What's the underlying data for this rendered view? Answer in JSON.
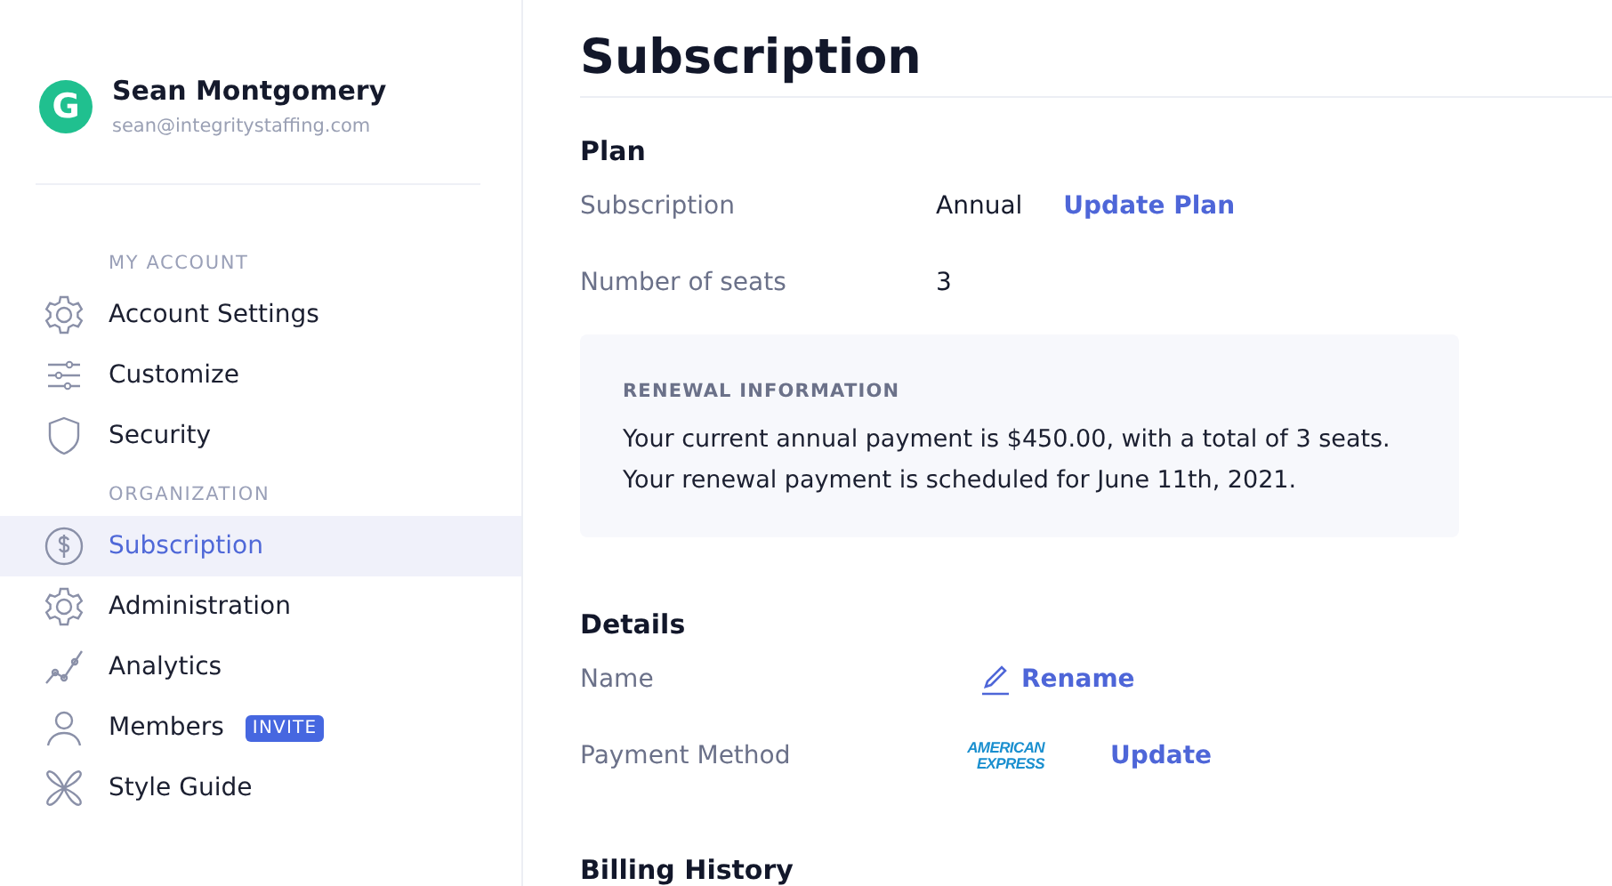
{
  "user": {
    "name": "Sean Montgomery",
    "email": "sean@integritystaffing.com",
    "avatar_letter": "G"
  },
  "sidebar": {
    "sections": [
      {
        "heading": "MY ACCOUNT",
        "items": [
          {
            "label": "Account Settings",
            "kind": "gear",
            "selected": false
          },
          {
            "label": "Customize",
            "kind": "sliders",
            "selected": false
          },
          {
            "label": "Security",
            "kind": "shield",
            "selected": false
          }
        ]
      },
      {
        "heading": "ORGANIZATION",
        "items": [
          {
            "label": "Subscription",
            "kind": "dollar",
            "selected": true
          },
          {
            "label": "Administration",
            "kind": "gear",
            "selected": false
          },
          {
            "label": "Analytics",
            "kind": "chart",
            "selected": false
          },
          {
            "label": "Members",
            "kind": "user",
            "selected": false,
            "badge": "INVITE"
          },
          {
            "label": "Style Guide",
            "kind": "flower",
            "selected": false
          }
        ]
      }
    ]
  },
  "page": {
    "title": "Subscription",
    "plan": {
      "heading": "Plan",
      "rows": [
        {
          "label": "Subscription",
          "value": "Annual",
          "link": "Update Plan"
        },
        {
          "label": "Number of seats",
          "value": "3"
        }
      ],
      "renewal": {
        "heading": "RENEWAL INFORMATION",
        "lines": [
          "Your current annual payment is $450.00, with a total of 3 seats.",
          "Your renewal payment is scheduled for June 11th, 2021."
        ]
      }
    },
    "details": {
      "heading": "Details",
      "name_label": "Name",
      "rename_link": "Rename",
      "payment_label": "Payment Method",
      "card_logo": [
        "AMERICAN",
        "EXPRESS"
      ],
      "payment_link": "Update"
    },
    "next_heading": "Billing History"
  }
}
